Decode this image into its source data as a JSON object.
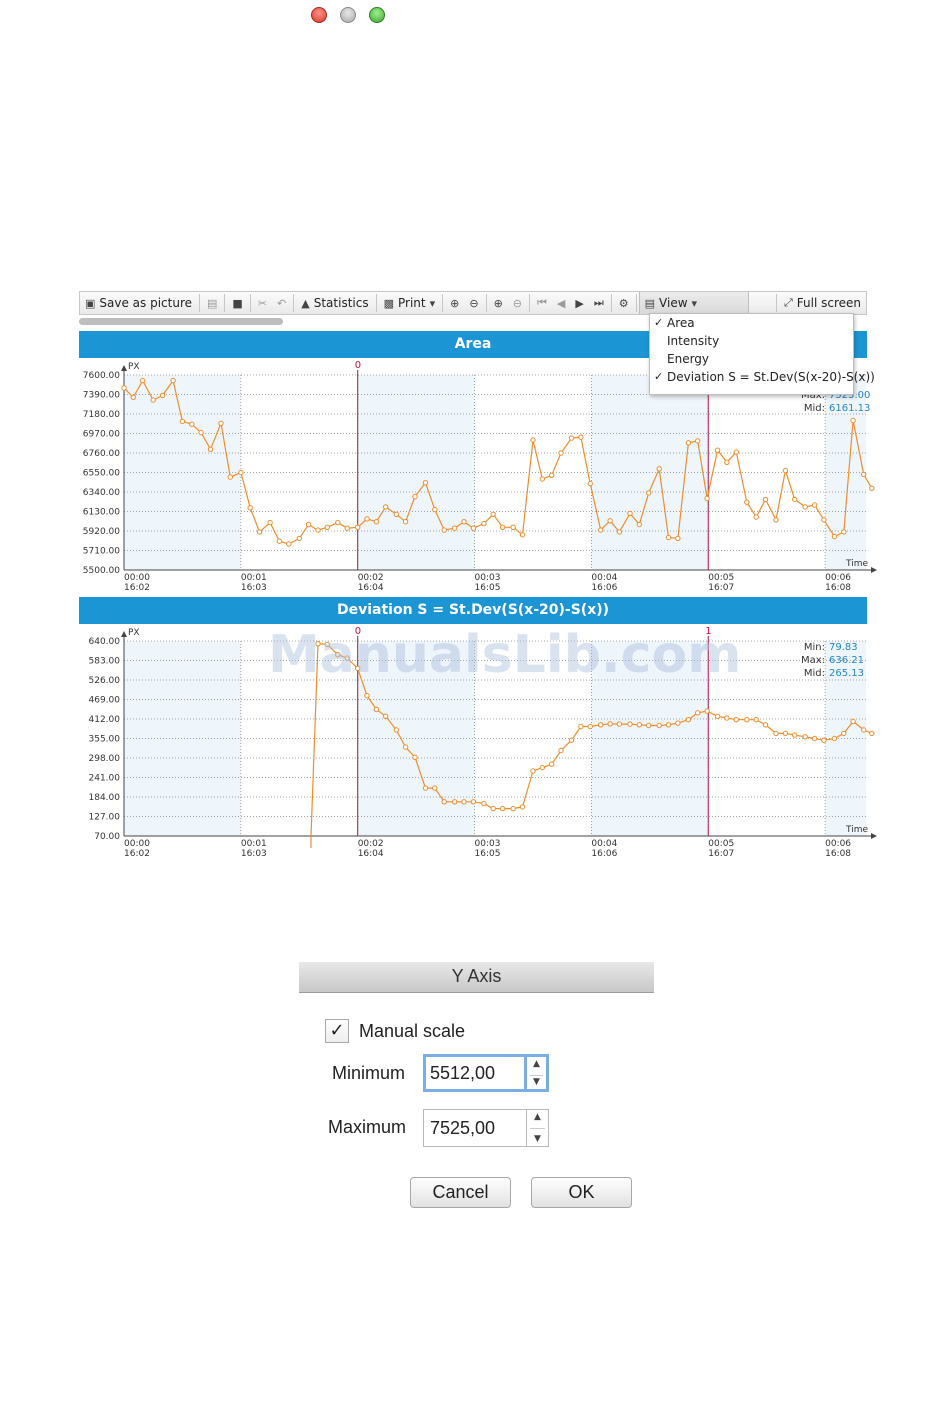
{
  "toolbar": {
    "save_label": "Save as picture",
    "statistics_label": "Statistics",
    "print_label": "Print",
    "view_label": "View",
    "fullscreen_label": "Full screen"
  },
  "view_menu": {
    "items": [
      {
        "label": "Area",
        "checked": true
      },
      {
        "label": "Intensity",
        "checked": false
      },
      {
        "label": "Energy",
        "checked": false
      },
      {
        "label": "Deviation S = St.Dev(S(x-20)-S(x))",
        "checked": true
      }
    ]
  },
  "watermark": "ManualsLib.com",
  "chart_data": [
    {
      "type": "line",
      "title": "Area",
      "ylabel": "PX",
      "xlabel": "Time",
      "ylim": [
        5500,
        7600
      ],
      "xlim": [
        0,
        6.35
      ],
      "y_ticks": [
        "7600.00",
        "7390.00",
        "7180.00",
        "6970.00",
        "6760.00",
        "6550.00",
        "6340.00",
        "6130.00",
        "5920.00",
        "5710.00",
        "5500.00"
      ],
      "x_ticks": [
        {
          "top": "00:00",
          "bottom": "16:02"
        },
        {
          "top": "00:01",
          "bottom": "16:03"
        },
        {
          "top": "00:02",
          "bottom": "16:04"
        },
        {
          "top": "00:03",
          "bottom": "16:05"
        },
        {
          "top": "00:04",
          "bottom": "16:06"
        },
        {
          "top": "00:05",
          "bottom": "16:07"
        },
        {
          "top": "00:06",
          "bottom": "16:08"
        }
      ],
      "markers": [
        {
          "x": 2.0,
          "label": "0"
        },
        {
          "x": 5.0,
          "label": ""
        }
      ],
      "stats": {
        "max_label": "Max:",
        "max": "7525.00",
        "mid_label": "Mid:",
        "mid": "6161.13"
      },
      "x": [
        0.0,
        0.08,
        0.16,
        0.25,
        0.33,
        0.42,
        0.5,
        0.58,
        0.66,
        0.74,
        0.83,
        0.91,
        1.0,
        1.08,
        1.16,
        1.25,
        1.33,
        1.41,
        1.5,
        1.58,
        1.66,
        1.74,
        1.83,
        1.91,
        2.0,
        2.08,
        2.16,
        2.24,
        2.33,
        2.41,
        2.49,
        2.58,
        2.66,
        2.74,
        2.83,
        2.91,
        2.99,
        3.08,
        3.16,
        3.24,
        3.33,
        3.41,
        3.5,
        3.58,
        3.66,
        3.74,
        3.83,
        3.91,
        3.99,
        4.08,
        4.16,
        4.24,
        4.33,
        4.41,
        4.49,
        4.58,
        4.66,
        4.74,
        4.83,
        4.91,
        4.99,
        5.08,
        5.16,
        5.24,
        5.33,
        5.41,
        5.49,
        5.58,
        5.66,
        5.74,
        5.83,
        5.91,
        5.99,
        6.08,
        6.16,
        6.24,
        6.33,
        6.4
      ],
      "values": [
        7460,
        7360,
        7540,
        7330,
        7380,
        7540,
        7100,
        7070,
        6980,
        6800,
        7080,
        6500,
        6550,
        6170,
        5910,
        6010,
        5810,
        5780,
        5840,
        5990,
        5930,
        5960,
        6010,
        5950,
        5960,
        6050,
        6020,
        6180,
        6100,
        6020,
        6290,
        6440,
        6150,
        5930,
        5950,
        6020,
        5950,
        6000,
        6100,
        5960,
        5960,
        5880,
        6900,
        6480,
        6520,
        6760,
        6920,
        6930,
        6430,
        5930,
        6030,
        5910,
        6110,
        5990,
        6330,
        6590,
        5850,
        5840,
        6870,
        6890,
        6270,
        6790,
        6660,
        6770,
        6230,
        6070,
        6260,
        6040,
        6570,
        6260,
        6180,
        6200,
        6040,
        5860,
        5910,
        7110,
        6530,
        6380
      ]
    },
    {
      "type": "line",
      "title": "Deviation S = St.Dev(S(x-20)-S(x))",
      "ylabel": "PX",
      "xlabel": "Time",
      "ylim": [
        70,
        640
      ],
      "xlim": [
        0,
        6.35
      ],
      "y_ticks": [
        "640.00",
        "583.00",
        "526.00",
        "469.00",
        "412.00",
        "355.00",
        "298.00",
        "241.00",
        "184.00",
        "127.00",
        "70.00"
      ],
      "x_ticks": [
        {
          "top": "00:00",
          "bottom": "16:02"
        },
        {
          "top": "00:01",
          "bottom": "16:03"
        },
        {
          "top": "00:02",
          "bottom": "16:04"
        },
        {
          "top": "00:03",
          "bottom": "16:05"
        },
        {
          "top": "00:04",
          "bottom": "16:06"
        },
        {
          "top": "00:05",
          "bottom": "16:07"
        },
        {
          "top": "00:06",
          "bottom": "16:08"
        }
      ],
      "markers": [
        {
          "x": 2.0,
          "label": "0"
        },
        {
          "x": 5.0,
          "label": "1"
        }
      ],
      "stats": {
        "min_label": "Min:",
        "min": "79.83",
        "max_label": "Max:",
        "max": "636.21",
        "mid_label": "Mid:",
        "mid": "265.13"
      },
      "x": [
        1.6,
        1.66,
        1.74,
        1.83,
        1.91,
        2.0,
        2.08,
        2.16,
        2.24,
        2.33,
        2.41,
        2.49,
        2.58,
        2.66,
        2.74,
        2.83,
        2.91,
        2.99,
        3.08,
        3.16,
        3.24,
        3.33,
        3.41,
        3.5,
        3.58,
        3.66,
        3.74,
        3.83,
        3.91,
        3.99,
        4.08,
        4.16,
        4.24,
        4.33,
        4.41,
        4.49,
        4.58,
        4.66,
        4.74,
        4.83,
        4.91,
        4.99,
        5.08,
        5.16,
        5.24,
        5.33,
        5.41,
        5.49,
        5.58,
        5.66,
        5.74,
        5.83,
        5.91,
        5.99,
        6.08,
        6.16,
        6.24,
        6.33,
        6.4
      ],
      "values": [
        70,
        632,
        630,
        600,
        590,
        560,
        480,
        440,
        420,
        380,
        330,
        300,
        210,
        210,
        170,
        170,
        170,
        170,
        165,
        150,
        150,
        150,
        155,
        260,
        270,
        280,
        320,
        350,
        390,
        390,
        395,
        398,
        397,
        397,
        395,
        393,
        393,
        395,
        400,
        410,
        430,
        435,
        420,
        415,
        410,
        410,
        410,
        395,
        370,
        370,
        365,
        360,
        355,
        350,
        355,
        370,
        405,
        380,
        370
      ]
    }
  ],
  "dialog": {
    "title": "Y Axis",
    "manual_scale_label": "Manual scale",
    "manual_scale_checked": true,
    "minimum_label": "Minimum",
    "minimum_value": "5512,00",
    "maximum_label": "Maximum",
    "maximum_value": "7525,00",
    "cancel_label": "Cancel",
    "ok_label": "OK"
  }
}
